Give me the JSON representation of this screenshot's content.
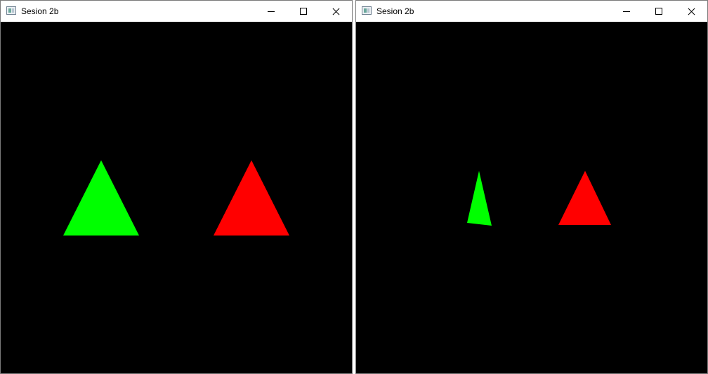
{
  "windows": [
    {
      "title": "Sesion 2b",
      "icon": "app-window-icon",
      "controls": [
        "minimize-icon",
        "maximize-icon",
        "close-icon"
      ],
      "canvas_background": "#000000",
      "shapes": [
        {
          "name": "green-triangle",
          "type": "triangle",
          "color": "#00ff00"
        },
        {
          "name": "red-triangle",
          "type": "triangle",
          "color": "#ff0000"
        }
      ]
    },
    {
      "title": "Sesion 2b",
      "icon": "app-window-icon",
      "controls": [
        "minimize-icon",
        "maximize-icon",
        "close-icon"
      ],
      "canvas_background": "#000000",
      "shapes": [
        {
          "name": "green-triangle-rotated",
          "type": "triangle",
          "color": "#00ff00"
        },
        {
          "name": "red-triangle-scaled",
          "type": "triangle",
          "color": "#ff0000"
        }
      ]
    }
  ]
}
